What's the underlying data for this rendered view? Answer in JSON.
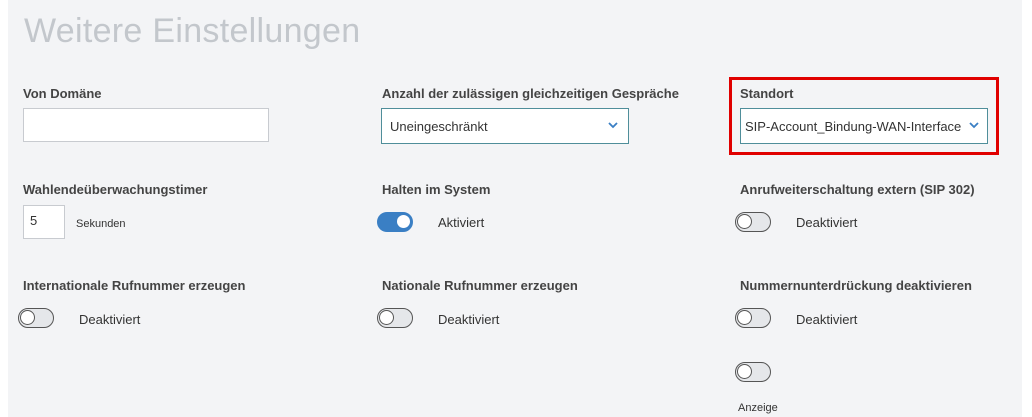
{
  "page": {
    "title": "Weitere Einstellungen"
  },
  "fields": {
    "from_domain": {
      "label": "Von Domäne",
      "value": ""
    },
    "max_calls": {
      "label": "Anzahl der zulässigen gleichzeitigen Gespräche",
      "value": "Uneingeschränkt"
    },
    "location": {
      "label": "Standort",
      "value": "SIP-Account_Bindung-WAN-Interface"
    },
    "dial_timer": {
      "label": "Wahlendeüberwachungstimer",
      "value": "5",
      "unit": "Sekunden"
    },
    "hold_in_system": {
      "label": "Halten im System",
      "state": "Aktiviert"
    },
    "call_forward_external": {
      "label": "Anrufweiterschaltung extern (SIP 302)",
      "state": "Deaktiviert"
    },
    "international_number": {
      "label": "Internationale Rufnummer erzeugen",
      "state": "Deaktiviert"
    },
    "national_number": {
      "label": "Nationale Rufnummer erzeugen",
      "state": "Deaktiviert"
    },
    "number_suppression": {
      "label": "Nummernunterdrückung deaktivieren",
      "state": "Deaktiviert"
    },
    "display": {
      "label": "Anzeige"
    }
  },
  "colors": {
    "highlight": "#e00000",
    "toggle_on": "#3a7fc4",
    "select_border": "#4f8e9a"
  },
  "icons": {
    "select_arrow": "chevron-down-icon"
  }
}
